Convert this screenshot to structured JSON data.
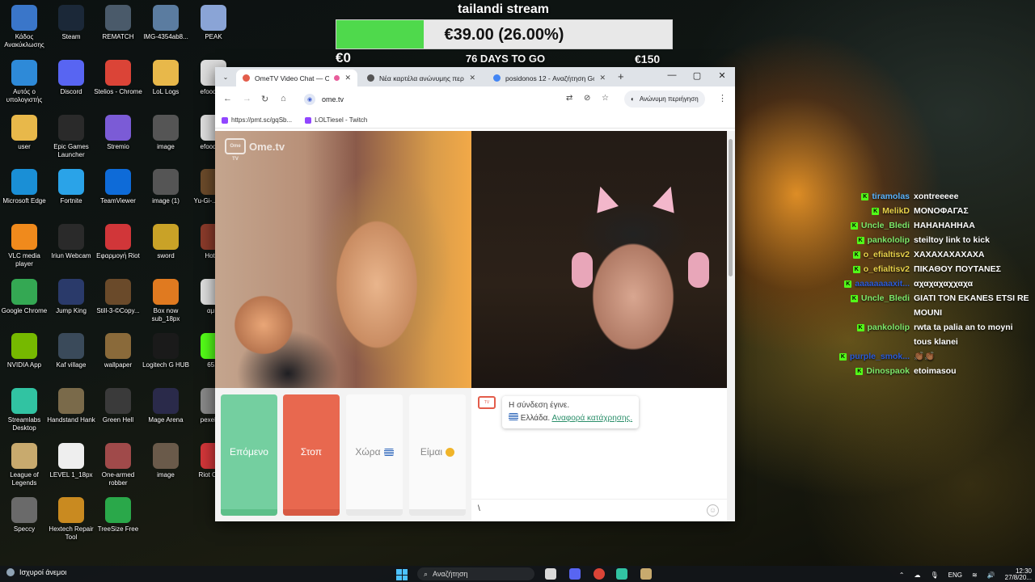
{
  "stream": {
    "title": "tailandi stream",
    "goal_text": "€39.00 (26.00%)",
    "goal_fraction": 0.26,
    "goal_min": "€0",
    "days_left": "76 DAYS TO GO",
    "goal_max": "€150"
  },
  "desktop_icons": [
    {
      "label": "Κάδος Ανακύκλωσης",
      "icon": "recycle-bin-icon",
      "color": "#3a76c9"
    },
    {
      "label": "Steam",
      "icon": "steam-icon",
      "color": "#1b2838"
    },
    {
      "label": "REMATCH",
      "icon": "game-icon",
      "color": "#4a5a6a"
    },
    {
      "label": "IMG-4354ab8...",
      "icon": "image-file-icon",
      "color": "#5b7ca0"
    },
    {
      "label": "PEAK",
      "icon": "game-icon",
      "color": "#8aa4d6"
    },
    {
      "label": "Αυτός ο υπολογιστής",
      "icon": "computer-icon",
      "color": "#2e8ad8"
    },
    {
      "label": "Discord",
      "icon": "discord-icon",
      "color": "#5865f2"
    },
    {
      "label": "Stelios - Chrome",
      "icon": "chrome-icon",
      "color": "#db4437"
    },
    {
      "label": "LoL Logs",
      "icon": "folder-icon",
      "color": "#e8b84a"
    },
    {
      "label": "efood s...",
      "icon": "file-icon",
      "color": "#dddddd"
    },
    {
      "label": "user",
      "icon": "folder-icon",
      "color": "#e8b84a"
    },
    {
      "label": "Epic Games Launcher",
      "icon": "epic-games-icon",
      "color": "#2a2a2a"
    },
    {
      "label": "Stremio",
      "icon": "stremio-icon",
      "color": "#7b5bd6"
    },
    {
      "label": "image",
      "icon": "image-file-icon",
      "color": "#555555"
    },
    {
      "label": "efood s...",
      "icon": "file-icon",
      "color": "#dddddd"
    },
    {
      "label": "Microsoft Edge",
      "icon": "edge-icon",
      "color": "#1a8fd6"
    },
    {
      "label": "Fortnite",
      "icon": "fortnite-icon",
      "color": "#2aa3e8"
    },
    {
      "label": "TeamViewer",
      "icon": "teamviewer-icon",
      "color": "#0e6bd8"
    },
    {
      "label": "image (1)",
      "icon": "image-file-icon",
      "color": "#555555"
    },
    {
      "label": "Yu-Gi-... Lin...",
      "icon": "game-icon",
      "color": "#6a4a2a"
    },
    {
      "label": "VLC media player",
      "icon": "vlc-icon",
      "color": "#f08a1c"
    },
    {
      "label": "Iriun Webcam",
      "icon": "webcam-icon",
      "color": "#2a2a2a"
    },
    {
      "label": "Εφαρμογή Riot",
      "icon": "riot-icon",
      "color": "#d13639"
    },
    {
      "label": "sword",
      "icon": "sword-icon",
      "color": "#c9a227"
    },
    {
      "label": "Hot ...",
      "icon": "game-icon",
      "color": "#8a3a2a"
    },
    {
      "label": "Google Chrome",
      "icon": "chrome-icon",
      "color": "#34a853"
    },
    {
      "label": "Jump King",
      "icon": "game-icon",
      "color": "#2a3a6a"
    },
    {
      "label": "Still-3-©Copy...",
      "icon": "image-file-icon",
      "color": "#6a4a2a"
    },
    {
      "label": "Box now sub_18px",
      "icon": "image-file-icon",
      "color": "#e07a20"
    },
    {
      "label": "αμ...",
      "icon": "file-icon",
      "color": "#dddddd"
    },
    {
      "label": "NVIDIA App",
      "icon": "nvidia-icon",
      "color": "#76b900"
    },
    {
      "label": "Kaf village",
      "icon": "game-icon",
      "color": "#3a4a5a"
    },
    {
      "label": "wallpaper",
      "icon": "image-file-icon",
      "color": "#8a6a3a"
    },
    {
      "label": "Logitech G HUB",
      "icon": "logitech-icon",
      "color": "#1a1a1a"
    },
    {
      "label": "65...",
      "icon": "file-icon",
      "color": "#53fc18"
    },
    {
      "label": "Streamlabs Desktop",
      "icon": "streamlabs-icon",
      "color": "#31c3a2"
    },
    {
      "label": "Handstand Hank",
      "icon": "game-icon",
      "color": "#7a6a4a"
    },
    {
      "label": "Green Hell",
      "icon": "game-icon",
      "color": "#3a3a3a"
    },
    {
      "label": "Mage Arena",
      "icon": "game-icon",
      "color": "#2a2a4a"
    },
    {
      "label": "pexels-...",
      "icon": "image-file-icon",
      "color": "#888888"
    },
    {
      "label": "League of Legends",
      "icon": "lol-icon",
      "color": "#c8aa6e"
    },
    {
      "label": "LEVEL 1_18px",
      "icon": "image-file-icon",
      "color": "#eeeeee"
    },
    {
      "label": "One-armed robber",
      "icon": "game-icon",
      "color": "#a04a4a"
    },
    {
      "label": "image",
      "icon": "image-file-icon",
      "color": "#6a5a4a"
    },
    {
      "label": "Riot Client",
      "icon": "riot-icon",
      "color": "#d13639"
    },
    {
      "label": "Speccy",
      "icon": "speccy-icon",
      "color": "#6a6a6a"
    },
    {
      "label": "Hextech Repair Tool",
      "icon": "hextech-icon",
      "color": "#c98a20"
    },
    {
      "label": "TreeSize Free",
      "icon": "treesize-icon",
      "color": "#2aa84a"
    }
  ],
  "chat": [
    {
      "user": "tiramolas",
      "color": "#5ab4ff",
      "message": "xontreeeee"
    },
    {
      "user": "MelikD",
      "color": "#e8d24a",
      "message": "ΜΟΝΟΦΑΓΑΣ"
    },
    {
      "user": "Uncle_Bledi",
      "color": "#7de86a",
      "message": "ΗΑΗΑΗΑΗΗΑΑ"
    },
    {
      "user": "pankololip",
      "color": "#7de86a",
      "message": "steiltoy link to kick"
    },
    {
      "user": "o_efialtisv2",
      "color": "#e8d24a",
      "message": "ΧΑΧΑΧΑΧΑΧΑΧΑ"
    },
    {
      "user": "o_efialtisv2",
      "color": "#e8d24a",
      "message": "ΠΙΚΑΘΟΥ ΠΟΥΤΑΝΕΣ"
    },
    {
      "user": "aaaaaaaaxit...",
      "color": "#2a5ad8",
      "message": "αχαχαχαχχαχα"
    },
    {
      "user": "Uncle_Bledi",
      "color": "#7de86a",
      "message": "GIATI TON EKANES ETSI RE MOUNI"
    },
    {
      "user": "pankololip",
      "color": "#7de86a",
      "message": "rwta ta palia an to moyni tous klanei"
    },
    {
      "user": "purple_smok...",
      "color": "#2a5ad8",
      "message": "👏🏾👏🏾"
    },
    {
      "user": "Dinospaok",
      "color": "#7de86a",
      "message": "etoimasou"
    }
  ],
  "browser": {
    "tabs": [
      {
        "title": "OmeTV Video Chat — Ome",
        "active": true,
        "icon": "ometv-icon",
        "color": "#e35d4b"
      },
      {
        "title": "Νέα καρτέλα ανώνυμης περιή",
        "active": false,
        "icon": "incognito-icon",
        "color": "#555555"
      },
      {
        "title": "posidonos 12 - Αναζήτηση Go",
        "active": false,
        "icon": "google-icon",
        "color": "#4285f4"
      }
    ],
    "close_glyph": "✕",
    "new_tab_glyph": "+",
    "url": "ome.tv",
    "incognito_label": "Ανώνυμη περιήγηση",
    "bookmarks": [
      {
        "label": "https://pmt.sc/gqSb...",
        "icon": "link-icon",
        "color": "#9146ff"
      },
      {
        "label": "LOLTiesel - Twitch",
        "icon": "twitch-icon",
        "color": "#9146ff"
      }
    ]
  },
  "ometv": {
    "logo": "Ome.tv",
    "logo_box": "Ome TV",
    "buttons": {
      "next": "Επόμενο",
      "stop": "Στοπ",
      "country": "Χώρα",
      "gender": "Είμαι"
    },
    "system_message": {
      "line1": "Η σύνδεση έγινε.",
      "country": "Ελλάδα.",
      "report_link": "Αναφορά κατάχρησης."
    },
    "chat_input_value": "\\"
  },
  "taskbar": {
    "weather": "Ισχυροί άνεμοι",
    "search_placeholder": "Αναζήτηση",
    "language": "ENG",
    "time": "12:30",
    "date": "27/8/20..."
  }
}
